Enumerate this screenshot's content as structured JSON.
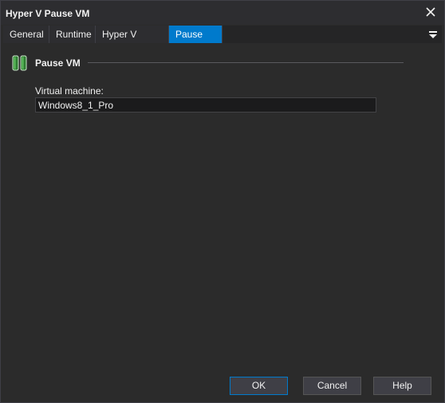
{
  "window": {
    "title": "Hyper V Pause VM"
  },
  "icons": {
    "close": "close-icon",
    "tab_menu": "tab-menu-icon",
    "group": "pause-vm-icon"
  },
  "tabs": [
    {
      "label": "General"
    },
    {
      "label": "Runtime"
    },
    {
      "label": "Hyper V Server"
    },
    {
      "label": "Pause VM"
    }
  ],
  "active_tab": "Pause VM",
  "group": {
    "title": "Pause VM"
  },
  "fields": {
    "virtual_machine": {
      "label": "Virtual machine:",
      "value": "Windows8_1_Pro"
    }
  },
  "buttons": {
    "ok": "OK",
    "cancel": "Cancel",
    "help": "Help"
  },
  "colors": {
    "accent": "#007acc",
    "background": "#2b2b2b",
    "icon_green": "#3a9a3a"
  }
}
